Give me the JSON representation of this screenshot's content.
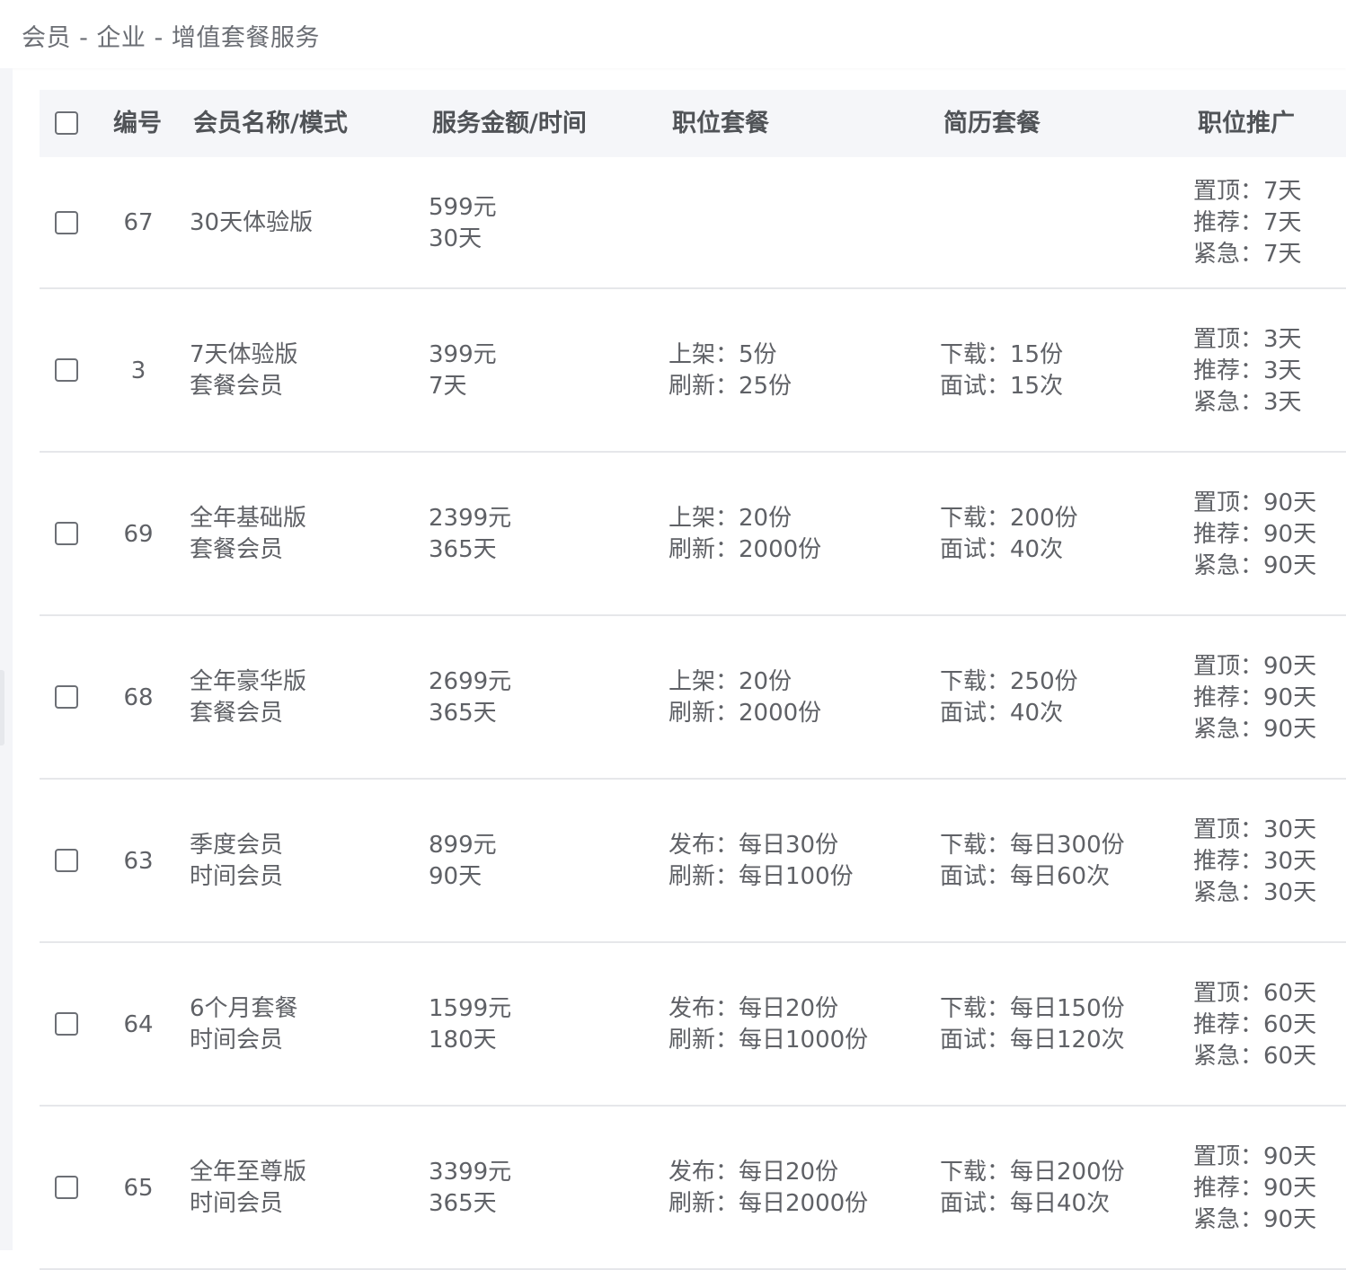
{
  "breadcrumb": "会员 - 企业 - 增值套餐服务",
  "columns": {
    "id": "编号",
    "name": "会员名称/模式",
    "price": "服务金额/时间",
    "jobs": "职位套餐",
    "resume": "简历套餐",
    "promo": "职位推广"
  },
  "rows": [
    {
      "id": "67",
      "name": [
        "30天体验版"
      ],
      "price": [
        "599元",
        "30天"
      ],
      "jobs": [],
      "resume": [],
      "promo": [
        "置顶：7天",
        "推荐：7天",
        "紧急：7天"
      ]
    },
    {
      "id": "3",
      "name": [
        "7天体验版",
        "套餐会员"
      ],
      "price": [
        "399元",
        "7天"
      ],
      "jobs": [
        "上架：5份",
        "刷新：25份"
      ],
      "resume": [
        "下载：15份",
        "面试：15次"
      ],
      "promo": [
        "置顶：3天",
        "推荐：3天",
        "紧急：3天"
      ]
    },
    {
      "id": "69",
      "name": [
        "全年基础版",
        "套餐会员"
      ],
      "price": [
        "2399元",
        "365天"
      ],
      "jobs": [
        "上架：20份",
        "刷新：2000份"
      ],
      "resume": [
        "下载：200份",
        "面试：40次"
      ],
      "promo": [
        "置顶：90天",
        "推荐：90天",
        "紧急：90天"
      ]
    },
    {
      "id": "68",
      "name": [
        "全年豪华版",
        "套餐会员"
      ],
      "price": [
        "2699元",
        "365天"
      ],
      "jobs": [
        "上架：20份",
        "刷新：2000份"
      ],
      "resume": [
        "下载：250份",
        "面试：40次"
      ],
      "promo": [
        "置顶：90天",
        "推荐：90天",
        "紧急：90天"
      ]
    },
    {
      "id": "63",
      "name": [
        "季度会员",
        "时间会员"
      ],
      "price": [
        "899元",
        "90天"
      ],
      "jobs": [
        "发布：每日30份",
        "刷新：每日100份"
      ],
      "resume": [
        "下载：每日300份",
        "面试：每日60次"
      ],
      "promo": [
        "置顶：30天",
        "推荐：30天",
        "紧急：30天"
      ]
    },
    {
      "id": "64",
      "name": [
        "6个月套餐",
        "时间会员"
      ],
      "price": [
        "1599元",
        "180天"
      ],
      "jobs": [
        "发布：每日20份",
        "刷新：每日1000份"
      ],
      "resume": [
        "下载：每日150份",
        "面试：每日120次"
      ],
      "promo": [
        "置顶：60天",
        "推荐：60天",
        "紧急：60天"
      ]
    },
    {
      "id": "65",
      "name": [
        "全年至尊版",
        "时间会员"
      ],
      "price": [
        "3399元",
        "365天"
      ],
      "jobs": [
        "发布：每日20份",
        "刷新：每日2000份"
      ],
      "resume": [
        "下载：每日200份",
        "面试：每日40次"
      ],
      "promo": [
        "置顶：90天",
        "推荐：90天",
        "紧急：90天"
      ]
    }
  ]
}
